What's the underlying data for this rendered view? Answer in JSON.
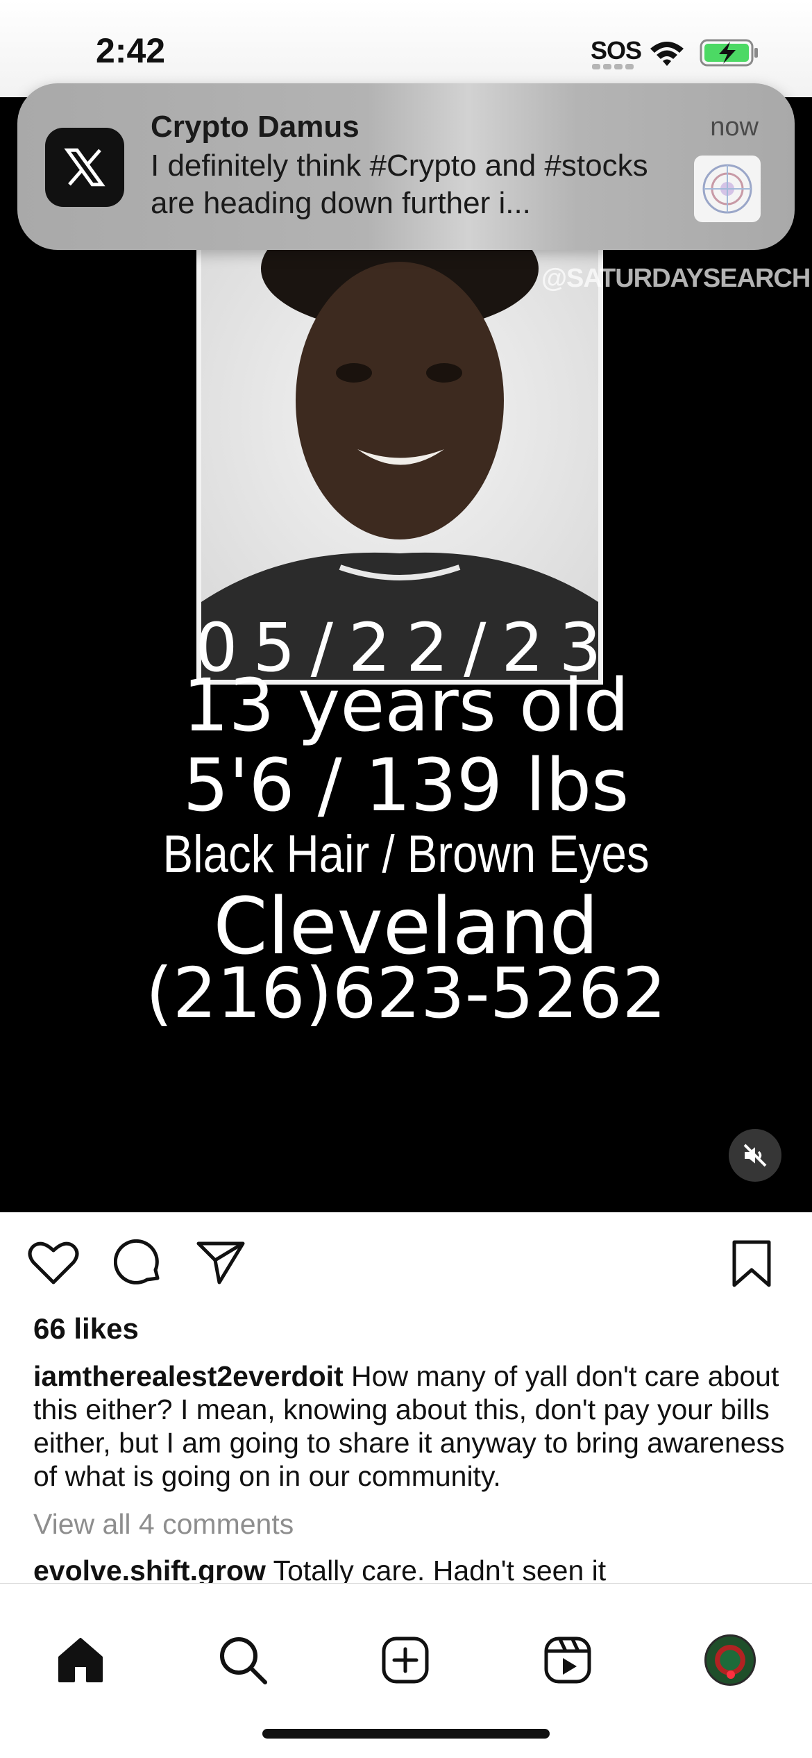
{
  "status_bar": {
    "time": "2:42",
    "sos": "SOS",
    "battery_color": "#4cd964"
  },
  "notification": {
    "app_icon": "x-logo-icon",
    "title": "Crypto Damus",
    "time": "now",
    "body": "I definitely think #Crypto and #stocks are heading down further i..."
  },
  "post_media": {
    "watermark": "@SATURDAYSEARCH",
    "date": "05/22/23",
    "age": "13 years old",
    "height_weight": "5'6 / 139 lbs",
    "hair_eyes": "Black Hair / Brown Eyes",
    "city": "Cleveland",
    "phone": "(216)623-5262",
    "mute_icon": "speaker-muted-icon"
  },
  "post": {
    "likes": "66 likes",
    "caption_user": "iamtherealest2everdoit",
    "caption_text": " How many of yall don't care about this either? I mean, knowing about this, don't pay your bills either, but I am going to share it anyway to bring awareness of what is going on in our community.",
    "view_comments": "View all 4 comments",
    "comment_user": "evolve.shift.grow",
    "comment_text": " Totally care. Hadn't seen it"
  },
  "icons": {
    "like": "heart-icon",
    "comment": "comment-bubble-icon",
    "share": "paper-plane-icon",
    "save": "bookmark-icon"
  },
  "tab_bar": {
    "items": [
      "home-icon",
      "search-icon",
      "create-post-icon",
      "reels-icon",
      "profile-avatar"
    ],
    "notification_dot_color": "#ff3040"
  }
}
